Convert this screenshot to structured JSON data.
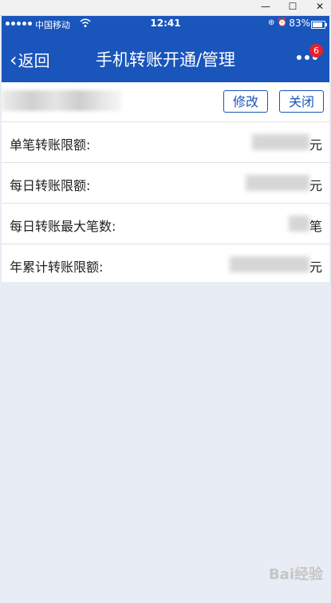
{
  "window": {
    "minimize": "—",
    "maximize": "☐",
    "close": "✕"
  },
  "status_bar": {
    "carrier": "中国移动",
    "time": "12:41",
    "battery": "83%",
    "icons": "⊕ ⏰"
  },
  "nav": {
    "back_label": "返回",
    "title": "手机转账开通/管理",
    "badge_count": "6"
  },
  "account_row": {
    "edit_label": "修改",
    "close_label": "关闭"
  },
  "limits": [
    {
      "label": "单笔转账限额:",
      "unit": "元"
    },
    {
      "label": "每日转账限额:",
      "unit": "元"
    },
    {
      "label": "每日转账最大笔数:",
      "unit": "笔"
    },
    {
      "label": "年累计转账限额:",
      "unit": "元"
    }
  ],
  "watermark": "Bai经验",
  "colors": {
    "header_blue": "#1a55bb",
    "badge_red": "#e8202a",
    "page_background": "#e8ecf4"
  },
  "icons": [
    "back-chevron-icon",
    "more-icon",
    "wifi-icon",
    "battery-icon",
    "signal-icon"
  ]
}
